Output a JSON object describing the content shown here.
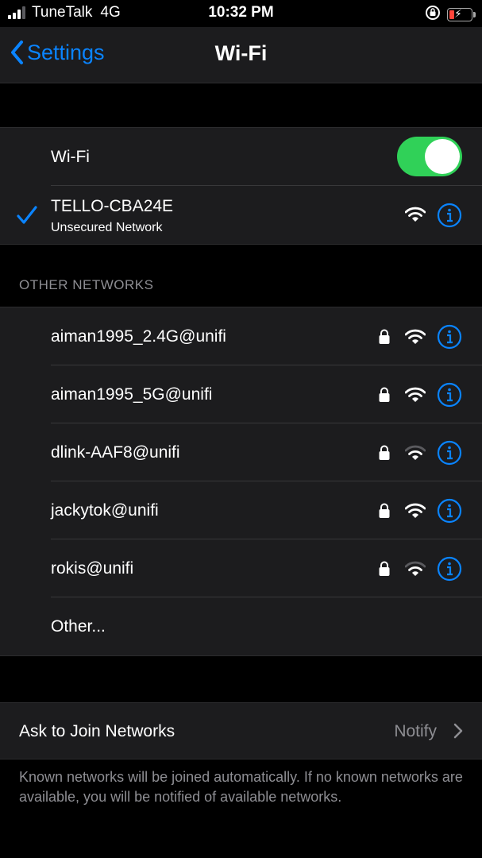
{
  "status_bar": {
    "carrier": "TuneTalk",
    "network_type": "4G",
    "time": "10:32 PM",
    "signal_bars_active": 3,
    "signal_bars_total": 4
  },
  "nav": {
    "back_label": "Settings",
    "title": "Wi-Fi"
  },
  "wifi_toggle": {
    "label": "Wi-Fi",
    "on": true,
    "color": "#30d158"
  },
  "connected": {
    "name": "TELLO-CBA24E",
    "subtitle": "Unsecured Network"
  },
  "other_networks": {
    "header": "OTHER NETWORKS",
    "items": [
      {
        "name": "aiman1995_2.4G@unifi",
        "locked": true,
        "strength": "strong"
      },
      {
        "name": "aiman1995_5G@unifi",
        "locked": true,
        "strength": "strong"
      },
      {
        "name": "dlink-AAF8@unifi",
        "locked": true,
        "strength": "weak"
      },
      {
        "name": "jackytok@unifi",
        "locked": true,
        "strength": "strong"
      },
      {
        "name": "rokis@unifi",
        "locked": true,
        "strength": "weak"
      }
    ],
    "other_label": "Other..."
  },
  "ask_to_join": {
    "label": "Ask to Join Networks",
    "value": "Notify"
  },
  "footer_text": "Known networks will be joined automatically. If no known networks are available, you will be notified of available networks.",
  "colors": {
    "accent": "#0a84ff",
    "toggle_on": "#30d158",
    "battery_low": "#ff453a"
  }
}
